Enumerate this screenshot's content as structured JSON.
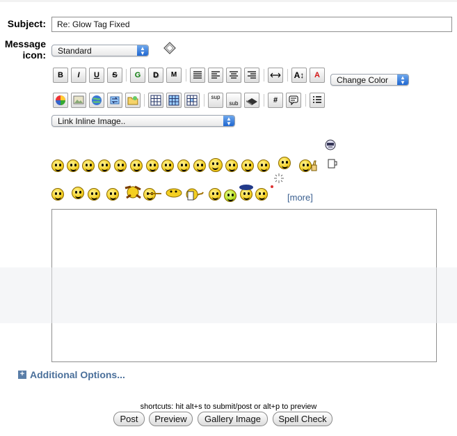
{
  "form": {
    "subject_label": "Subject:",
    "subject_value": "Re: Glow Tag Fixed",
    "message_icon_label_1": "Message",
    "message_icon_label_2": "icon:",
    "message_icon_value": "Standard"
  },
  "toolbar": {
    "bold": "B",
    "italic": "I",
    "underline": "U",
    "strike": "S",
    "glow": "G",
    "shadow": "D",
    "marquee": "M",
    "change_color": "Change Color",
    "sup": "sup",
    "sub": "sub",
    "hash": "#",
    "link_select": "Link Inline Image.."
  },
  "smileys": {
    "more_label": "[more]"
  },
  "footer": {
    "additional_options": "Additional Options...",
    "shortcuts": "shortcuts: hit alt+s to submit/post or alt+p to preview",
    "post": "Post",
    "preview": "Preview",
    "gallery_image": "Gallery Image",
    "spell_check": "Spell Check"
  },
  "colors": {
    "link_blue": "#4a6f9a",
    "select_arrow": "#1f67d1"
  }
}
